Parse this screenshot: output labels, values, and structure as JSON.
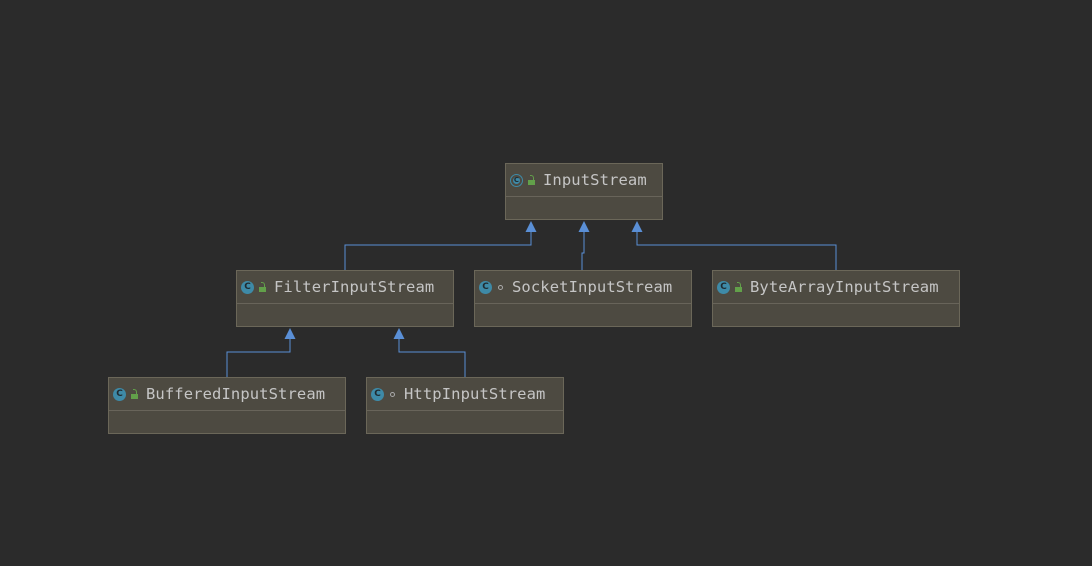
{
  "diagram": {
    "background": "#2b2b2b",
    "node_color": "#4d4a41",
    "edge_color": "#5a8fd6",
    "nodes": [
      {
        "id": "InputStream",
        "name": "InputStream",
        "kind": "abstract-class",
        "visibility": "public",
        "icon": "abstract-class-icon"
      },
      {
        "id": "FilterInputStream",
        "name": "FilterInputStream",
        "kind": "class",
        "visibility": "public",
        "icon": "class-icon"
      },
      {
        "id": "SocketInputStream",
        "name": "SocketInputStream",
        "kind": "class",
        "visibility": "package-private",
        "icon": "class-icon"
      },
      {
        "id": "ByteArrayInputStream",
        "name": "ByteArrayInputStream",
        "kind": "class",
        "visibility": "public",
        "icon": "class-icon"
      },
      {
        "id": "BufferedInputStream",
        "name": "BufferedInputStream",
        "kind": "class",
        "visibility": "public",
        "icon": "class-icon"
      },
      {
        "id": "HttpInputStream",
        "name": "HttpInputStream",
        "kind": "class",
        "visibility": "package-private",
        "icon": "class-icon"
      }
    ],
    "edges": [
      {
        "from": "FilterInputStream",
        "to": "InputStream",
        "type": "extends"
      },
      {
        "from": "SocketInputStream",
        "to": "InputStream",
        "type": "extends"
      },
      {
        "from": "ByteArrayInputStream",
        "to": "InputStream",
        "type": "extends"
      },
      {
        "from": "BufferedInputStream",
        "to": "FilterInputStream",
        "type": "extends"
      },
      {
        "from": "HttpInputStream",
        "to": "FilterInputStream",
        "type": "extends"
      }
    ]
  }
}
